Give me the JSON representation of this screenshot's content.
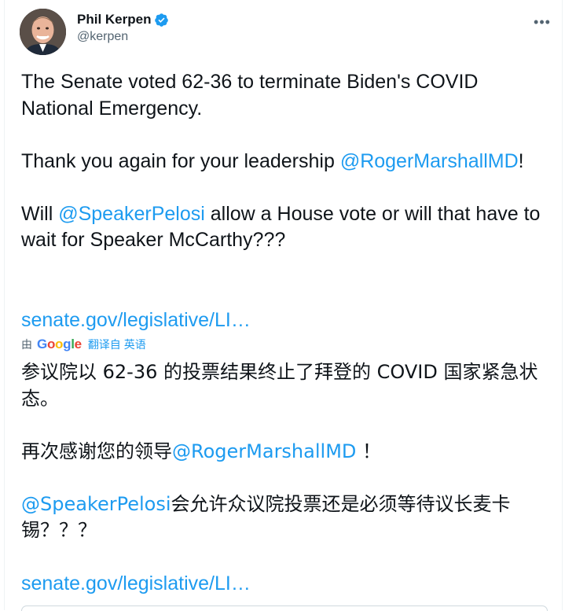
{
  "author": {
    "display_name": "Phil Kerpen",
    "handle": "@kerpen",
    "verified_icon": "verified-badge-icon",
    "avatar_icon": "avatar-portrait"
  },
  "more_icon": "more-options-icon",
  "more_glyph": "•••",
  "tweet_en": {
    "line1": "The Senate voted 62-36 to terminate Biden's COVID National Emergency.",
    "line2_pre": "Thank you again for your leadership ",
    "line2_mention": "@RogerMarshallMD",
    "line2_post": "!",
    "line3_pre": "Will ",
    "line3_mention": "@SpeakerPelosi",
    "line3_post": " allow a House vote or will that have to wait for Speaker McCarthy???"
  },
  "link_en": "senate.gov/legislative/LI…",
  "translation_bar": {
    "by": "由",
    "google": [
      "G",
      "o",
      "o",
      "g",
      "l",
      "e"
    ],
    "translated_from": "翻译自 英语"
  },
  "tweet_zh": {
    "line1": "参议院以 62-36 的投票结果终止了拜登的 COVID 国家紧急状态。",
    "line2_pre": "再次感谢您的领导",
    "line2_mention": "@RogerMarshallMD",
    "line2_post": " ！",
    "line3_mention": "@SpeakerPelosi",
    "line3_post": "会允许众议院投票还是必须等待议长麦卡锡？？？"
  },
  "link_zh": "senate.gov/legislative/LI…",
  "colors": {
    "link": "#1d9bf0",
    "text": "#0f1419",
    "secondary": "#536471",
    "verified": "#1d9bf0"
  }
}
